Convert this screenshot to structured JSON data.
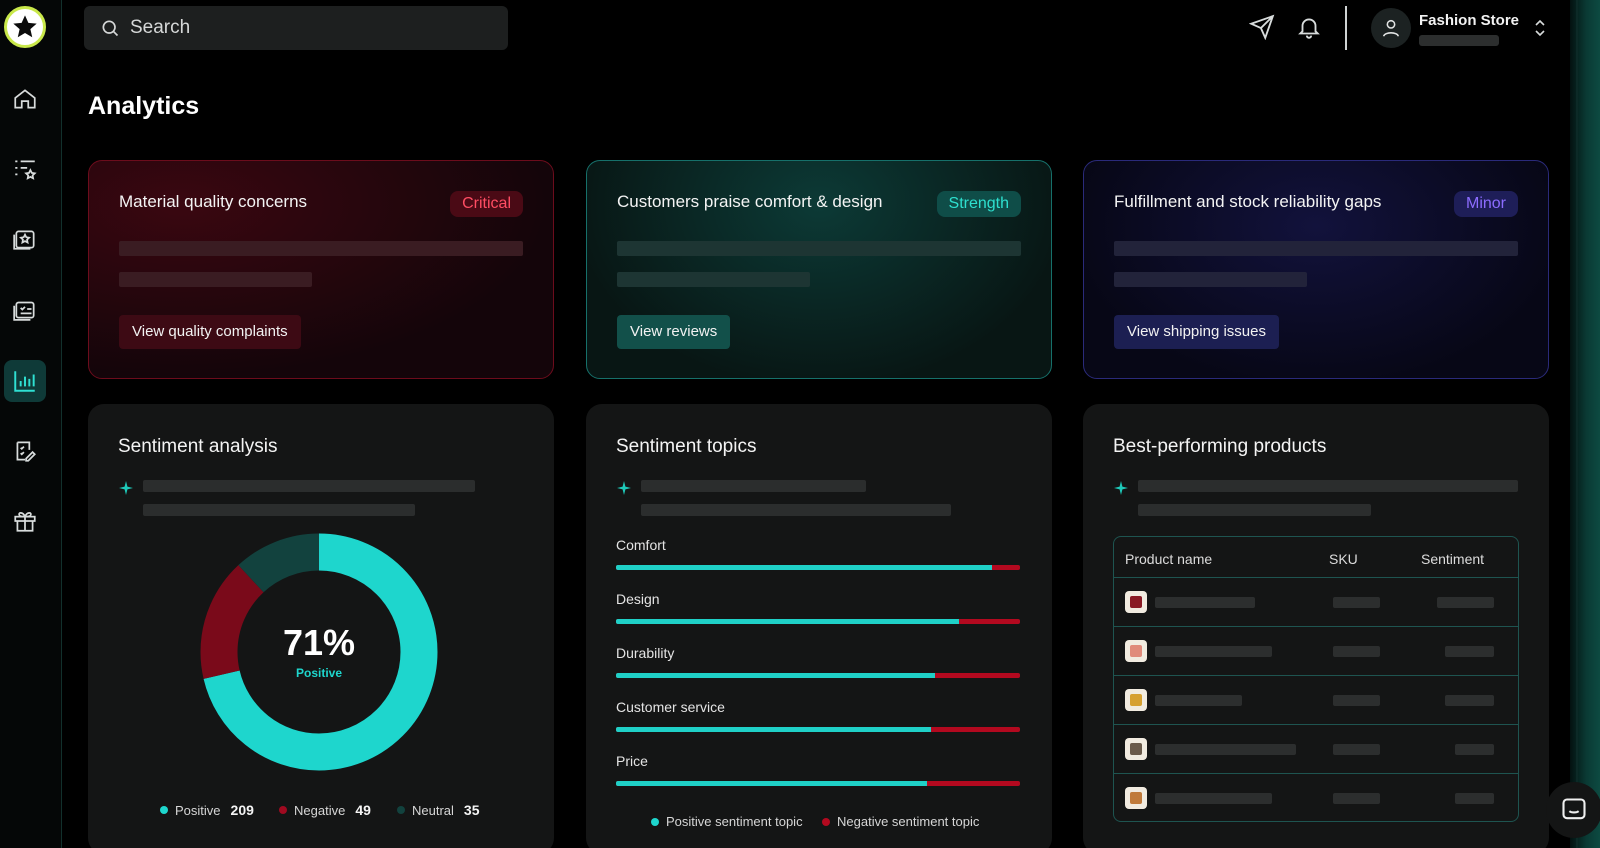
{
  "search": {
    "placeholder": "Search"
  },
  "user": {
    "name": "Fashion Store"
  },
  "page": {
    "title": "Analytics"
  },
  "insights": [
    {
      "title": "Material quality concerns",
      "badge": "Critical",
      "button": "View quality complaints",
      "color": "#ff4d63"
    },
    {
      "title": "Customers praise comfort & design",
      "badge": "Strength",
      "button": "View reviews",
      "color": "#2ee0cf"
    },
    {
      "title": "Fulfillment and stock reliability gaps",
      "badge": "Minor",
      "button": "View shipping issues",
      "color": "#8c6cff"
    }
  ],
  "sentiment": {
    "title": "Sentiment analysis",
    "percent_label": "71%",
    "center_label": "Positive",
    "legend": [
      {
        "label": "Positive",
        "count": "209",
        "color": "#1ed6cd"
      },
      {
        "label": "Negative",
        "count": "49",
        "color": "#7a0a1a"
      },
      {
        "label": "Neutral",
        "count": "35",
        "color": "#12423e"
      }
    ]
  },
  "chart_data": {
    "type": "pie",
    "title": "",
    "labels": [
      "Positive",
      "Negative",
      "Neutral"
    ],
    "values": [
      209,
      49,
      35
    ],
    "colors": [
      "#1ed6cd",
      "#7a0a1a",
      "#12423e"
    ]
  },
  "topics": {
    "title": "Sentiment topics",
    "items": [
      {
        "label": "Comfort",
        "positive": 0.93
      },
      {
        "label": "Design",
        "positive": 0.85
      },
      {
        "label": "Durability",
        "positive": 0.79
      },
      {
        "label": "Customer service",
        "positive": 0.78
      },
      {
        "label": "Price",
        "positive": 0.77
      }
    ],
    "legend_positive": "Positive sentiment topic",
    "legend_negative": "Negative sentiment topic"
  },
  "products": {
    "title": "Best-performing products",
    "columns": [
      "Product name",
      "SKU",
      "Sentiment"
    ]
  }
}
